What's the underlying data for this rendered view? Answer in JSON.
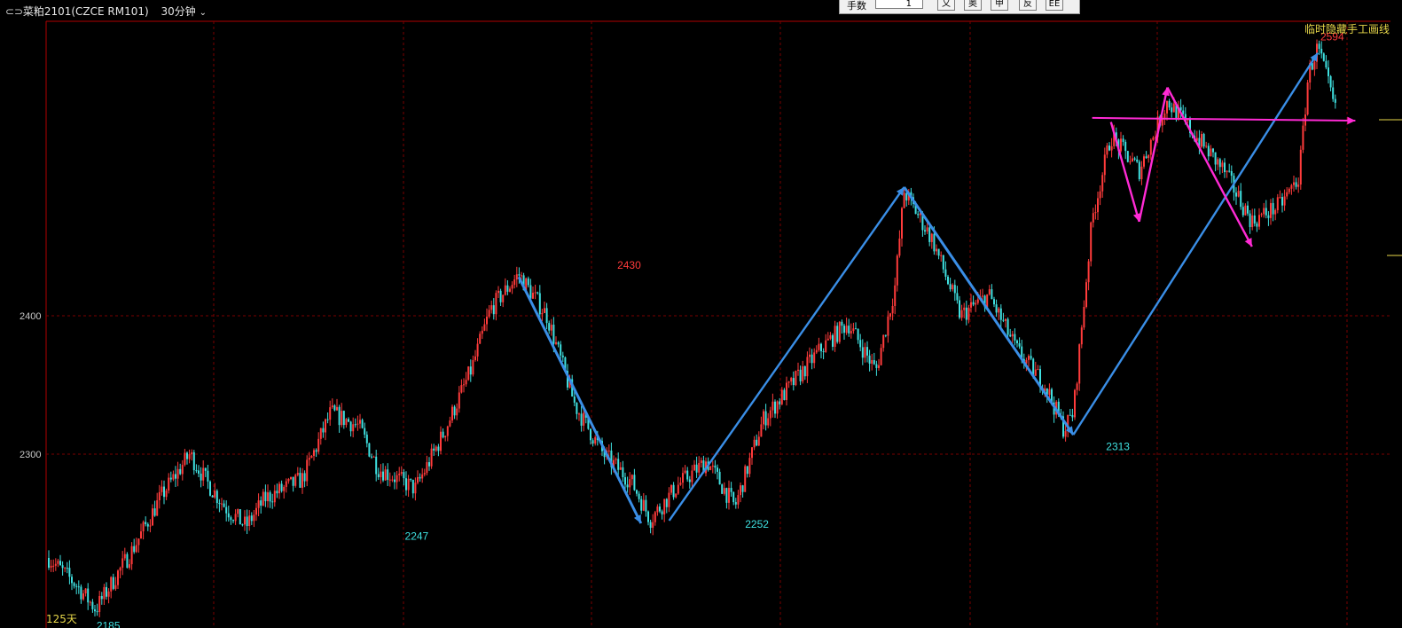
{
  "header": {
    "icon": "window-icon",
    "symbol": "菜粕2101(CZCE RM101)",
    "period": "30分钟",
    "period_chevron": "chevron-down-icon"
  },
  "toolbar": {
    "label": "手数",
    "value": "1",
    "buttons": [
      "又",
      "奥",
      "甲",
      "反",
      "EE"
    ]
  },
  "overlay_text": {
    "hide_lines": "临时隐藏手工画线",
    "period_label": "125天"
  },
  "colors": {
    "background": "#000000",
    "up": "#ff3b3b",
    "down": "#3fe0e0",
    "grid": "#7a0000",
    "axis": "#b00000",
    "arrow_blue": "#3a8ee6",
    "arrow_magenta": "#ff2ad4",
    "highlight": "#e8d84a"
  },
  "chart_data": {
    "type": "candlestick",
    "y_axis": {
      "ticks": [
        2300,
        2400
      ],
      "ylim": [
        2176,
        2616
      ]
    },
    "grid": true,
    "annotations": [
      {
        "text": "2185",
        "color": "down"
      },
      {
        "text": "2247",
        "color": "down"
      },
      {
        "text": "2430",
        "color": "up"
      },
      {
        "text": "2252",
        "color": "down"
      },
      {
        "text": "2313",
        "color": "down"
      },
      {
        "text": "2594",
        "color": "up"
      }
    ],
    "price_path": [
      [
        0,
        2225
      ],
      [
        3,
        2205
      ],
      [
        5,
        2188
      ],
      [
        9,
        2232
      ],
      [
        12,
        2270
      ],
      [
        15,
        2300
      ],
      [
        17,
        2278
      ],
      [
        19,
        2260
      ],
      [
        21,
        2248
      ],
      [
        23,
        2268
      ],
      [
        27,
        2282
      ],
      [
        30,
        2330
      ],
      [
        33,
        2320
      ],
      [
        35,
        2290
      ],
      [
        39,
        2275
      ],
      [
        42,
        2315
      ],
      [
        45,
        2362
      ],
      [
        47,
        2405
      ],
      [
        50,
        2430
      ],
      [
        53,
        2400
      ],
      [
        56,
        2335
      ],
      [
        59,
        2300
      ],
      [
        62,
        2280
      ],
      [
        64,
        2253
      ],
      [
        67,
        2278
      ],
      [
        70,
        2295
      ],
      [
        73,
        2262
      ],
      [
        76,
        2325
      ],
      [
        79,
        2350
      ],
      [
        82,
        2375
      ],
      [
        85,
        2395
      ],
      [
        88,
        2360
      ],
      [
        90,
        2420
      ],
      [
        91,
        2490
      ],
      [
        94,
        2455
      ],
      [
        97,
        2400
      ],
      [
        100,
        2415
      ],
      [
        103,
        2375
      ],
      [
        106,
        2350
      ],
      [
        108,
        2318
      ],
      [
        109,
        2330
      ],
      [
        111,
        2470
      ],
      [
        113,
        2530
      ],
      [
        116,
        2505
      ],
      [
        119,
        2555
      ],
      [
        122,
        2530
      ],
      [
        125,
        2505
      ],
      [
        128,
        2468
      ],
      [
        131,
        2480
      ],
      [
        133,
        2500
      ],
      [
        134,
        2575
      ],
      [
        135,
        2594
      ],
      [
        136,
        2570
      ],
      [
        137,
        2545
      ]
    ],
    "lines": [
      {
        "type": "trend",
        "color": "arrow_blue",
        "from": [
          50,
          2428
        ],
        "to": [
          63,
          2250
        ]
      },
      {
        "type": "trend",
        "color": "arrow_blue",
        "from": [
          66,
          2252
        ],
        "to": [
          91,
          2493
        ]
      },
      {
        "type": "trend",
        "color": "arrow_blue",
        "from": [
          91,
          2493
        ],
        "to": [
          109,
          2314
        ]
      },
      {
        "type": "trend",
        "color": "arrow_blue",
        "from": [
          109,
          2314
        ],
        "to": [
          135,
          2590
        ]
      },
      {
        "type": "trend",
        "color": "arrow_magenta",
        "from": [
          113,
          2540
        ],
        "to": [
          116,
          2468
        ]
      },
      {
        "type": "trend",
        "color": "arrow_magenta",
        "from": [
          116,
          2468
        ],
        "to": [
          119,
          2565
        ]
      },
      {
        "type": "trend",
        "color": "arrow_magenta",
        "from": [
          119,
          2565
        ],
        "to": [
          128,
          2450
        ]
      },
      {
        "type": "horizontal",
        "color": "arrow_magenta",
        "from": [
          111,
          2543
        ],
        "to": [
          139,
          2541
        ]
      }
    ]
  }
}
